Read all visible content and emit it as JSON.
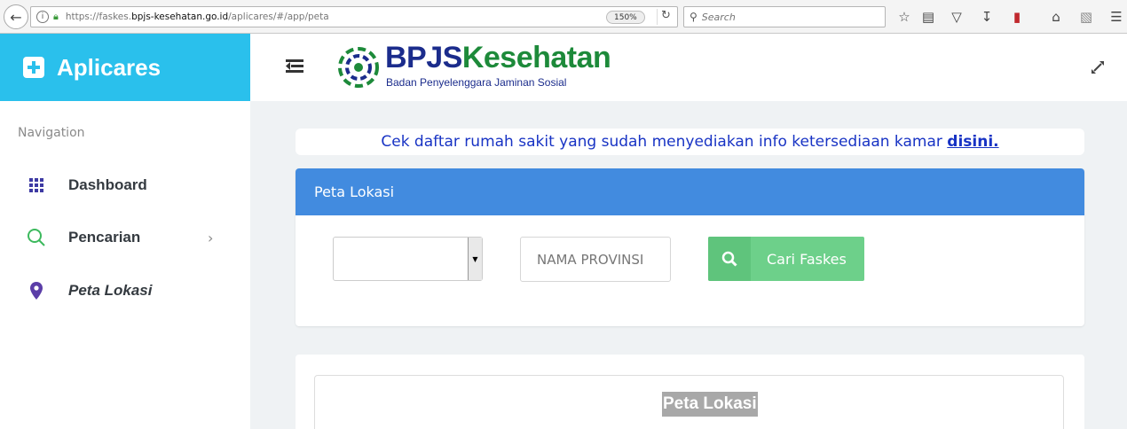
{
  "browser": {
    "url_prefix": "https://faskes.",
    "url_domain": "bpjs-kesehatan.go.id",
    "url_path": "/aplicares/#/app/peta",
    "zoom": "150%",
    "search_placeholder": "Search"
  },
  "sidebar": {
    "brand": "Aplicares",
    "heading": "Navigation",
    "items": [
      {
        "label": "Dashboard",
        "icon": "grid-icon",
        "color": "#3d3aa3"
      },
      {
        "label": "Pencarian",
        "icon": "search-icon",
        "color": "#3cb95d"
      },
      {
        "label": "Peta Lokasi",
        "icon": "map-pin-icon",
        "color": "#5b3ea8"
      }
    ]
  },
  "header": {
    "logo_bpjs": "BPJS",
    "logo_kes": "Kesehatan",
    "logo_sub": "Badan Penyelenggara Jaminan Sosial"
  },
  "notice": {
    "text": "Cek daftar rumah sakit yang sudah menyediakan info ketersediaan kamar ",
    "link": "disini."
  },
  "panel": {
    "title": "Peta Lokasi",
    "select_type_value": "",
    "province_placeholder": "NAMA PROVINSI",
    "search_button": "Cari Faskes"
  },
  "map": {
    "title": "Peta Lokasi"
  },
  "colors": {
    "brand": "#2ac0ec",
    "panel_header": "#428bdf",
    "button": "#6dd08a",
    "notice_text": "#1833c4"
  }
}
